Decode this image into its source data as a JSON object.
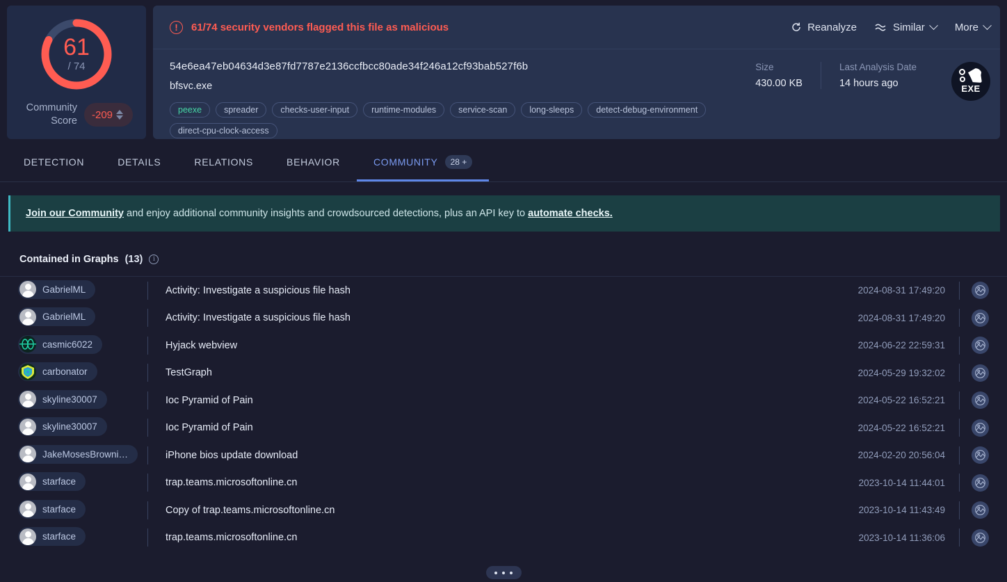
{
  "score": {
    "detections": "61",
    "total": "/ 74",
    "ratio_value": 61,
    "ratio_total": 74,
    "community_label_line1": "Community",
    "community_label_line2": "Score",
    "community_value": "-209",
    "arc_color": "#ff5c52",
    "track_color": "#3c4a6b"
  },
  "alert": {
    "icon": "exclamation-circle-icon",
    "text": "61/74 security vendors flagged this file as malicious",
    "color": "#ff5c52"
  },
  "actions": [
    {
      "label": "Reanalyze",
      "icon": "refresh-icon",
      "has_chevron": false
    },
    {
      "label": "Similar",
      "icon": "waves-icon",
      "has_chevron": true
    },
    {
      "label": "More",
      "icon": "",
      "has_chevron": true
    }
  ],
  "file": {
    "hash": "54e6ea47eb04634d3e87fd7787e2136ccfbcc80ade34f246a12cf93bab527f6b",
    "name": "bfsvc.exe",
    "tags": [
      {
        "label": "peexe",
        "accent": true
      },
      {
        "label": "spreader",
        "accent": false
      },
      {
        "label": "checks-user-input",
        "accent": false
      },
      {
        "label": "runtime-modules",
        "accent": false
      },
      {
        "label": "service-scan",
        "accent": false
      },
      {
        "label": "long-sleeps",
        "accent": false
      },
      {
        "label": "detect-debug-environment",
        "accent": false
      },
      {
        "label": "direct-cpu-clock-access",
        "accent": false
      }
    ],
    "meta": [
      {
        "key": "Size",
        "value": "430.00 KB"
      },
      {
        "key": "Last Analysis Date",
        "value": "14 hours ago"
      }
    ],
    "type_badge": "EXE",
    "type_badge_icon": "exe-file-icon"
  },
  "tabs": [
    {
      "label": "DETECTION",
      "active": false,
      "badge": ""
    },
    {
      "label": "DETAILS",
      "active": false,
      "badge": ""
    },
    {
      "label": "RELATIONS",
      "active": false,
      "badge": ""
    },
    {
      "label": "BEHAVIOR",
      "active": false,
      "badge": ""
    },
    {
      "label": "COMMUNITY",
      "active": true,
      "badge": "28 +"
    }
  ],
  "banner": {
    "link1": "Join our Community",
    "middle": " and enjoy additional community insights and crowdsourced detections, plus an API key to ",
    "link2": "automate checks.",
    "accent": "#3fb9c4"
  },
  "graphs_section": {
    "title": "Contained in Graphs",
    "count": "(13)",
    "info_icon": "info-icon"
  },
  "graph_rows": [
    {
      "user": "GabrielML",
      "avatar": "default",
      "title": "Activity: Investigate a suspicious file hash",
      "date": "2024-08-31 17:49:20"
    },
    {
      "user": "GabrielML",
      "avatar": "default",
      "title": "Activity: Investigate a suspicious file hash",
      "date": "2024-08-31 17:49:20"
    },
    {
      "user": "casmic6022",
      "avatar": "teal-pattern",
      "title": "Hyjack webview",
      "date": "2024-06-22 22:59:31"
    },
    {
      "user": "carbonator",
      "avatar": "green-shield",
      "title": "TestGraph",
      "date": "2024-05-29 19:32:02"
    },
    {
      "user": "skyline30007",
      "avatar": "default",
      "title": "Ioc Pyramid of Pain",
      "date": "2024-05-22 16:52:21"
    },
    {
      "user": "skyline30007",
      "avatar": "default",
      "title": "Ioc Pyramid of Pain",
      "date": "2024-05-22 16:52:21"
    },
    {
      "user": "JakeMosesBrowni…",
      "avatar": "default",
      "title": "iPhone bios update download",
      "date": "2024-02-20 20:56:04"
    },
    {
      "user": "starface",
      "avatar": "default",
      "title": "trap.teams.microsoftonline.cn",
      "date": "2023-10-14 11:44:01"
    },
    {
      "user": "starface",
      "avatar": "default",
      "title": "Copy of trap.teams.microsoftonline.cn",
      "date": "2023-10-14 11:43:49"
    },
    {
      "user": "starface",
      "avatar": "default",
      "title": "trap.teams.microsoftonline.cn",
      "date": "2023-10-14 11:36:06"
    }
  ],
  "footer": {
    "more_icon": "ellipsis-icon"
  }
}
